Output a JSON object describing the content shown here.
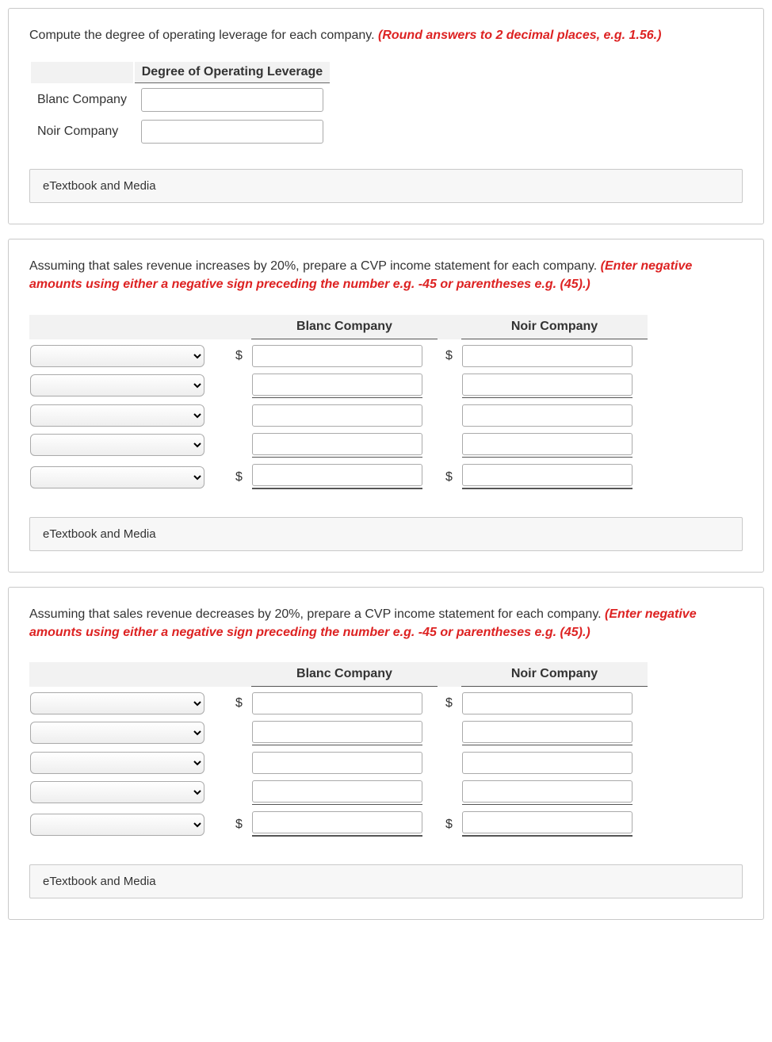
{
  "panel1": {
    "prompt_plain": "Compute the degree of operating leverage for each company. ",
    "prompt_hint": "(Round answers to 2 decimal places, e.g. 1.56.)",
    "header": "Degree of Operating Leverage",
    "row1_label": "Blanc Company",
    "row2_label": "Noir Company",
    "etext": "eTextbook and Media"
  },
  "panel2": {
    "prompt_plain": "Assuming that sales revenue increases by 20%, prepare a CVP income statement for each company. ",
    "prompt_hint": "(Enter negative amounts using either a negative sign preceding the number e.g. -45 or parentheses e.g. (45).)",
    "col1": "Blanc Company",
    "col2": "Noir Company",
    "dollar": "$",
    "etext": "eTextbook and Media"
  },
  "panel3": {
    "prompt_plain": "Assuming that sales revenue decreases by 20%, prepare a CVP income statement for each company. ",
    "prompt_hint": "(Enter negative amounts using either a negative sign preceding the number e.g. -45 or parentheses e.g. (45).)",
    "col1": "Blanc Company",
    "col2": "Noir Company",
    "dollar": "$",
    "etext": "eTextbook and Media"
  }
}
